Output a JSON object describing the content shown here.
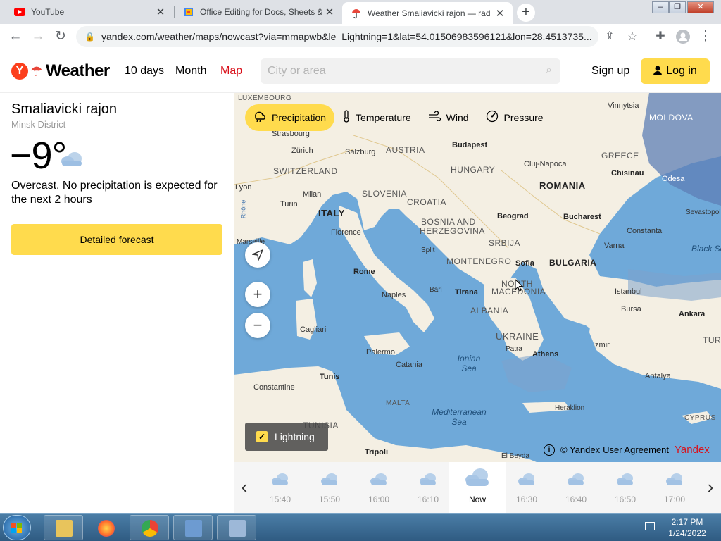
{
  "browser": {
    "tabs": [
      {
        "title": "YouTube",
        "favicon": "youtube-icon",
        "active": false
      },
      {
        "title": "Office Editing for Docs, Sheets &",
        "favicon": "office-editing-icon",
        "active": false
      },
      {
        "title": "Weather Smaliavicki rajon — rad",
        "favicon": "yandex-weather-icon",
        "active": true
      }
    ],
    "new_tab_label": "+",
    "url": "yandex.com/weather/maps/nowcast?via=mmapwb&le_Lightning=1&lat=54.01506983596121&lon=28.4513735..."
  },
  "header": {
    "logo_letter": "Y",
    "brand": "Weather",
    "nav": [
      "10 days",
      "Month",
      "Map"
    ],
    "search_placeholder": "City or area",
    "signup_label": "Sign up",
    "login_label": "Log in"
  },
  "current": {
    "place": "Smaliavicki rajon",
    "district": "Minsk District",
    "temperature": "−9°",
    "condition_icon": "cloud-icon",
    "description": "Overcast. No precipitation is expected for the next 2 hours",
    "detailed_button": "Detailed forecast"
  },
  "map": {
    "layers": [
      {
        "label": "Precipitation",
        "icon": "precipitation-icon",
        "active": true
      },
      {
        "label": "Temperature",
        "icon": "thermometer-icon",
        "active": false
      },
      {
        "label": "Wind",
        "icon": "wind-icon",
        "active": false
      },
      {
        "label": "Pressure",
        "icon": "pressure-icon",
        "active": false
      }
    ],
    "lightning_label": "Lightning",
    "lightning_checked": true,
    "attribution": "© Yandex",
    "user_agreement": "User Agreement",
    "yandex_mark": "Yandex",
    "labels": {
      "countries": [
        "LUXEMBOURG",
        "AUSTRIA",
        "HUNGARY",
        "SWITZERLAND",
        "SLOVENIA",
        "CROATIA",
        "ITALY",
        "BOSNIA AND",
        "HERZEGOVINA",
        "SRBIJA",
        "MONTENEGRO",
        "NORTH",
        "MACEDONIA",
        "ALBANIA",
        "BULGARIA",
        "ROMANIA",
        "GREECE",
        "MOLDOVA",
        "UKRAINE",
        "MALTA",
        "TUNISIA",
        "CYPRUS",
        "TURKEY"
      ],
      "cities": [
        "Strasbourg",
        "Zürich",
        "Salzburg",
        "Budapest",
        "Vinnytsia",
        "Cluj-Napoca",
        "Chisinau",
        "Odesa",
        "Lyon",
        "Milan",
        "Turin",
        "Beograd",
        "Bucharest",
        "Sevastopol",
        "Florence",
        "Split",
        "Constanta",
        "Marseille",
        "Varna",
        "Sofia",
        "Rome",
        "Naples",
        "Bari",
        "Tirana",
        "Istanbul",
        "Bursa",
        "Ankara",
        "Cagliari",
        "Patra",
        "Athens",
        "Izmir",
        "Palermo",
        "Catania",
        "Antalya",
        "Constantine",
        "Tunis",
        "Heraklion",
        "Tripoli",
        "El Beyda",
        "Rhône"
      ],
      "seas": [
        "Ionian Sea",
        "Mediterranean Sea",
        "Black Sea"
      ]
    }
  },
  "timeline": {
    "times": [
      "15:40",
      "15:50",
      "16:00",
      "16:10",
      "Now",
      "16:30",
      "16:40",
      "16:50",
      "17:00"
    ],
    "current_label": "Now"
  },
  "taskbar": {
    "apps": [
      "file-explorer-icon",
      "firefox-icon",
      "chrome-icon",
      "control-panel-icon",
      "remote-desktop-icon"
    ],
    "time": "2:17 PM",
    "date": "1/24/2022"
  },
  "colors": {
    "accent_yellow": "#ffdb4d",
    "brand_red": "#fc3f1d",
    "nav_active_red": "#d9111b",
    "sea_blue": "#6fa9d9",
    "land": "#f4efe3"
  }
}
